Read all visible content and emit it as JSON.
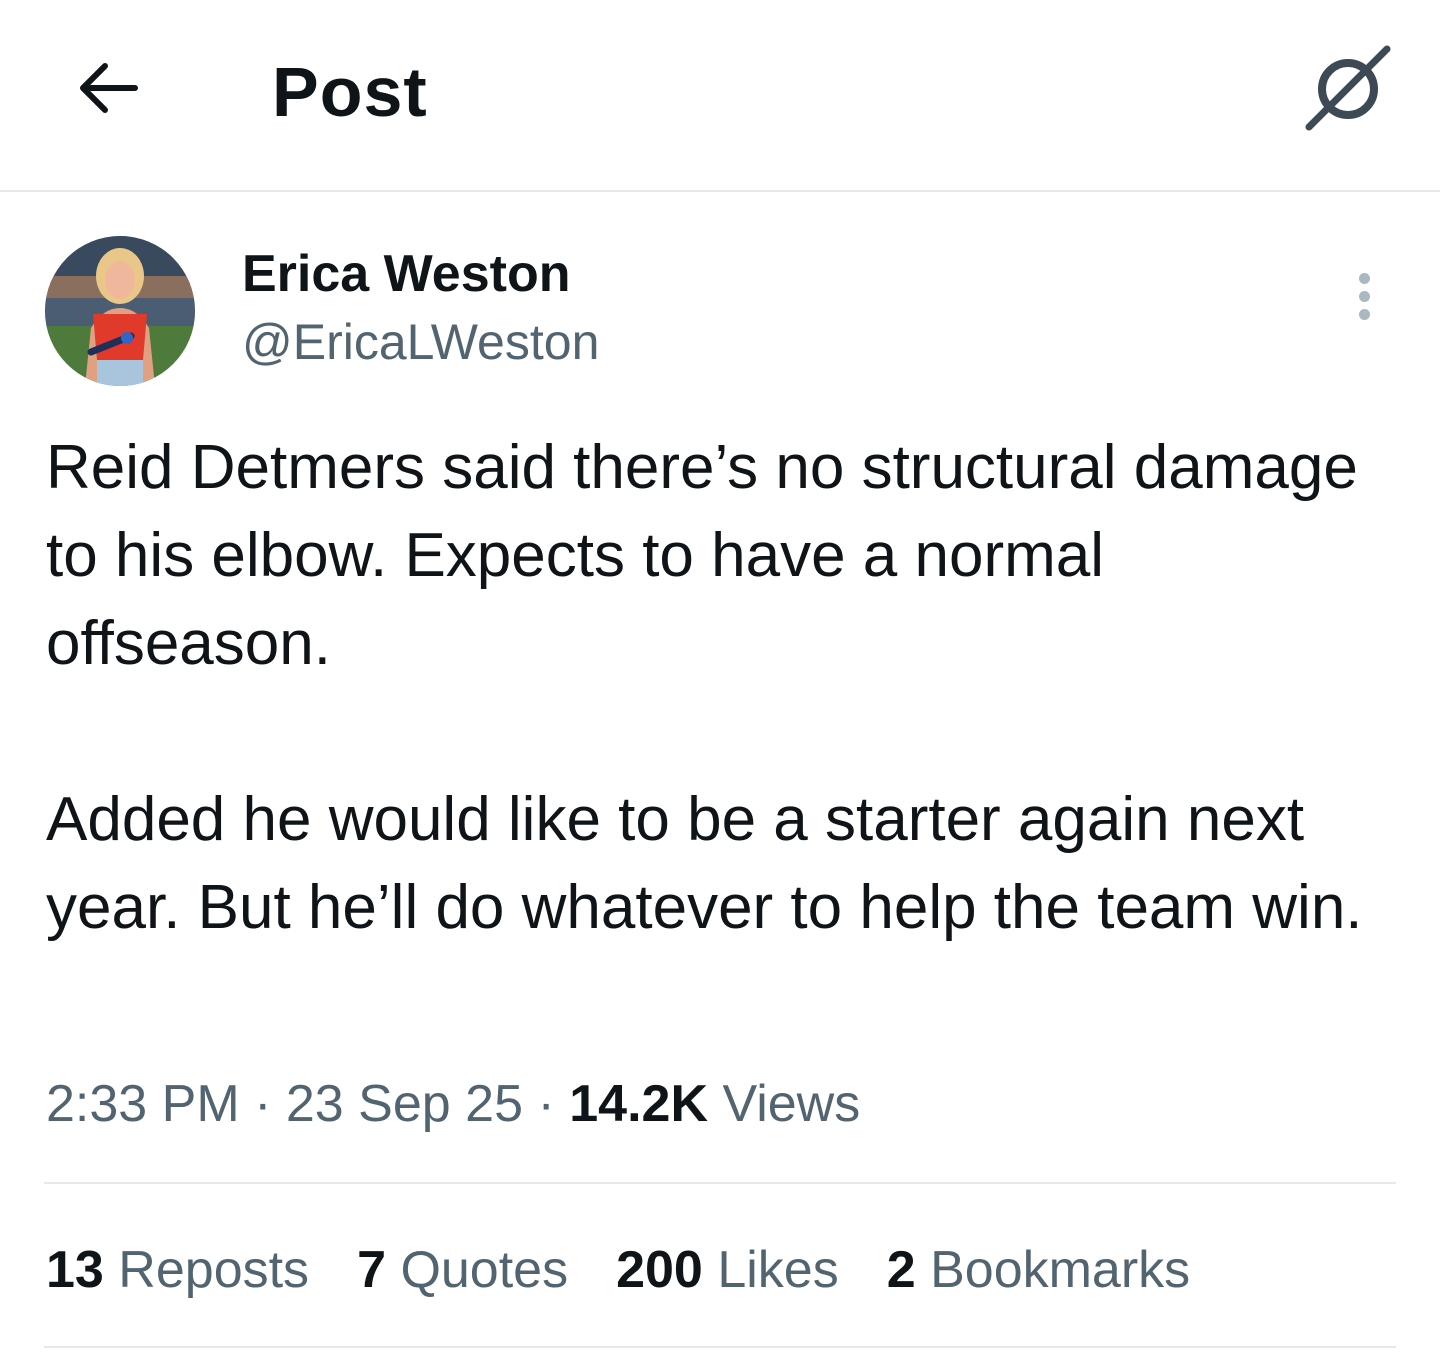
{
  "header": {
    "title": "Post",
    "back_icon": "arrow-left-icon",
    "grok_icon": "grok-icon"
  },
  "post": {
    "author": {
      "name": "Erica Weston",
      "handle": "@EricaLWeston"
    },
    "text": "Reid Detmers said there’s no structural damage to his elbow. Expects to have a normal offseason.\n\nAdded he would like to be a starter again next year. But he’ll do whatever to help the team win.",
    "time": "2:33 PM",
    "separator": "·",
    "date": "23 Sep 25",
    "views_count": "14.2K",
    "views_label": "Views"
  },
  "stats": {
    "reposts_count": "13",
    "reposts_label": "Reposts",
    "quotes_count": "7",
    "quotes_label": "Quotes",
    "likes_count": "200",
    "likes_label": "Likes",
    "bookmarks_count": "2",
    "bookmarks_label": "Bookmarks"
  },
  "colors": {
    "text_primary": "#0f1419",
    "text_secondary": "#536471",
    "divider": "#e6e9eb",
    "background": "#ffffff"
  }
}
